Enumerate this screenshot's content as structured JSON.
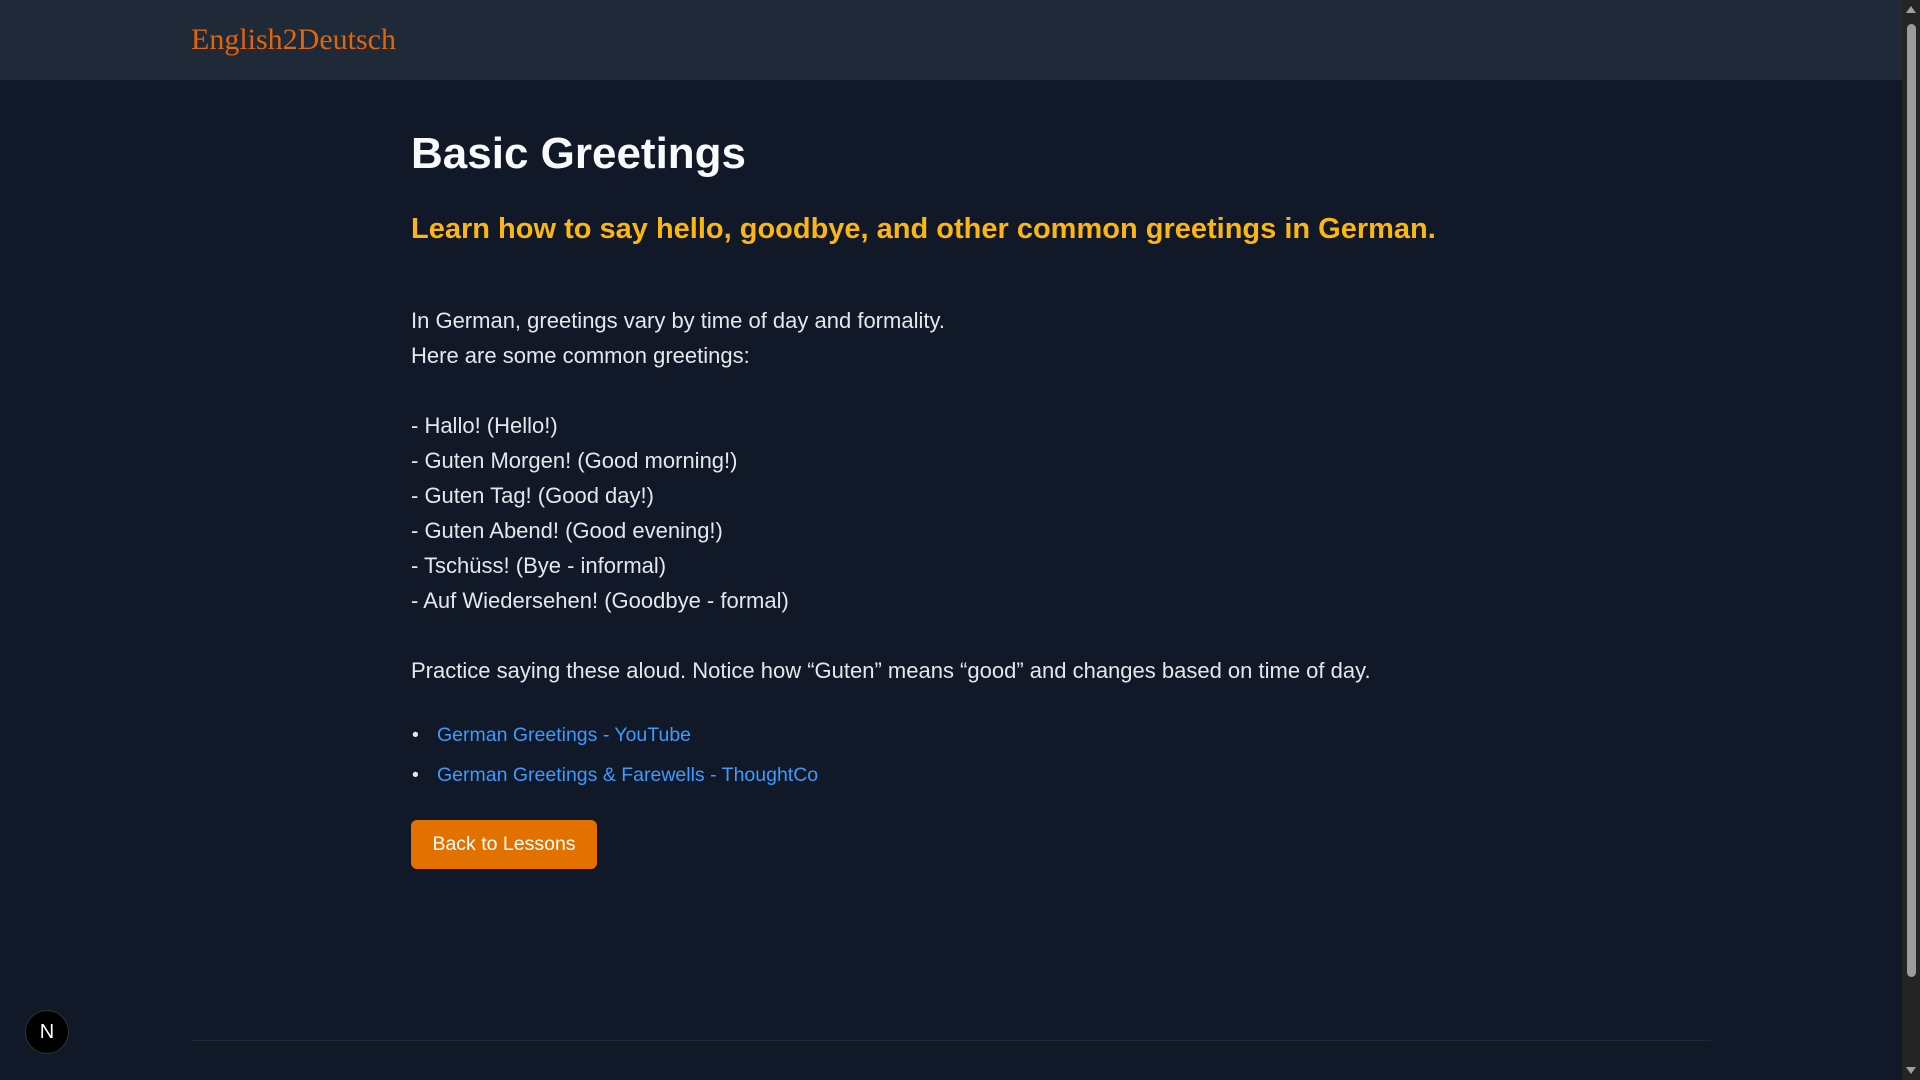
{
  "header": {
    "logo": "English2Deutsch"
  },
  "lesson": {
    "title": "Basic Greetings",
    "subtitle": "Learn how to say hello, goodbye, and other common greetings in German.",
    "content_lines": [
      "In German, greetings vary by time of day and formality.",
      "Here are some common greetings:",
      "",
      "- Hallo! (Hello!)",
      "- Guten Morgen! (Good morning!)",
      "- Guten Tag! (Good day!)",
      "- Guten Abend! (Good evening!)",
      "- Tschüss! (Bye - informal)",
      "- Auf Wiedersehen! (Goodbye - formal)",
      "",
      "Practice saying these aloud. Notice how “Guten” means “good” and changes based on time of day."
    ],
    "links": [
      {
        "label": "German Greetings - YouTube"
      },
      {
        "label": "German Greetings & Farewells - ThoughtCo"
      }
    ],
    "bullet": "•",
    "back_button": "Back to Lessons"
  },
  "dev_badge": {
    "label": "N"
  },
  "colors": {
    "background": "#111827",
    "header": "#1f2937",
    "logo": "#e0650b",
    "subtitle": "#fbb614",
    "link": "#3b9cff",
    "button": "#e27100"
  }
}
